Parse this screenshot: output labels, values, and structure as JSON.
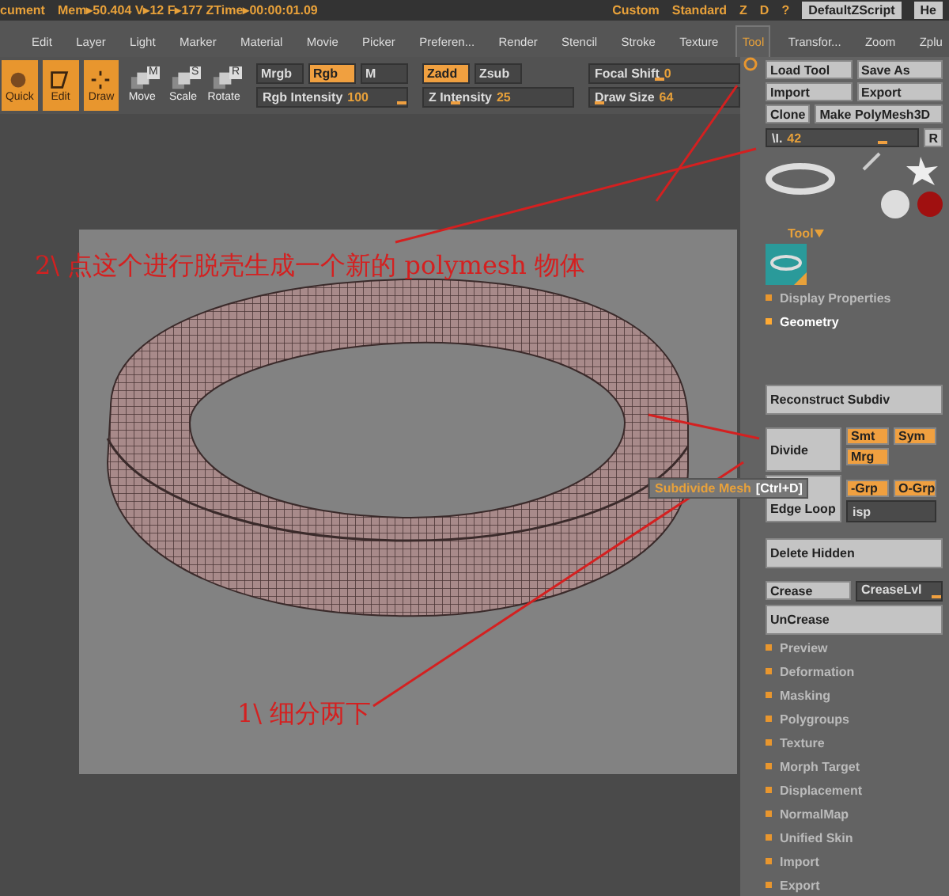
{
  "title_bar": {
    "document": "cument",
    "stats": "Mem▸50.404 V▸12 F▸177 ZTime▸00:00:01.09",
    "layout_items": [
      "Custom",
      "Standard",
      "Z",
      "D",
      "?"
    ],
    "buttons": [
      "DefaultZScript",
      "He"
    ]
  },
  "menu": [
    {
      "label": "Edit",
      "selected": false
    },
    {
      "label": "Layer",
      "selected": false
    },
    {
      "label": "Light",
      "selected": false
    },
    {
      "label": "Marker",
      "selected": false
    },
    {
      "label": "Material",
      "selected": false
    },
    {
      "label": "Movie",
      "selected": false
    },
    {
      "label": "Picker",
      "selected": false
    },
    {
      "label": "Preferen...",
      "selected": false
    },
    {
      "label": "Render",
      "selected": false
    },
    {
      "label": "Stencil",
      "selected": false
    },
    {
      "label": "Stroke",
      "selected": false
    },
    {
      "label": "Texture",
      "selected": false
    },
    {
      "label": "Tool",
      "selected": true
    },
    {
      "label": "Transfor...",
      "selected": false
    },
    {
      "label": "Zoom",
      "selected": false
    },
    {
      "label": "Zplu",
      "selected": false
    }
  ],
  "toolbar": {
    "modes": [
      {
        "label": "Quick",
        "kind": "quick",
        "on": true
      },
      {
        "label": "Edit",
        "kind": "edit",
        "on": true
      },
      {
        "label": "Draw",
        "kind": "draw",
        "on": true
      },
      {
        "label": "Move",
        "kind": "move",
        "letter": "M",
        "on": false
      },
      {
        "label": "Scale",
        "kind": "scale",
        "letter": "S",
        "on": false
      },
      {
        "label": "Rotate",
        "kind": "rotate",
        "letter": "R",
        "on": false
      }
    ],
    "groups": [
      {
        "toggles": [
          {
            "label": "Mrgb",
            "on": false
          },
          {
            "label": "Rgb",
            "on": true
          },
          {
            "label": "M",
            "on": false
          }
        ],
        "sliders": [
          {
            "label": "Rgb Intensity",
            "value": "100",
            "level": 1.0
          }
        ]
      },
      {
        "toggles": [
          {
            "label": "Zadd",
            "on": true
          },
          {
            "label": "Zsub",
            "on": false
          }
        ],
        "sliders": [
          {
            "label": "Z Intensity",
            "value": "25",
            "level": 0.25
          }
        ]
      },
      {
        "sliders": [
          {
            "label": "Focal Shift",
            "value": "0",
            "level": 0.5
          },
          {
            "label": "Draw Size",
            "value": "64",
            "level": 0.1
          }
        ]
      }
    ]
  },
  "annotations": [
    {
      "text": "2\\ 点这个进行脱壳生成一个新的 polymesh 物体",
      "kind": "top"
    },
    {
      "text": "1\\ 细分两下",
      "kind": "bottom"
    }
  ],
  "tooltip": {
    "text": "Subdivide Mesh",
    "shortcut": "[Ctrl+D]"
  },
  "tool_panel": {
    "button_rows": [
      [
        "Load Tool",
        "Save As"
      ],
      [
        "Import",
        "Export"
      ],
      [
        "Clone",
        "Make PolyMesh3D"
      ]
    ],
    "slider": {
      "label": "\\I.",
      "value": "42",
      "level": 0.8,
      "button": "R"
    },
    "tool_menu": "Tool",
    "sections_top": [
      {
        "label": "Display Properties",
        "expanded": false
      },
      {
        "label": "Geometry",
        "expanded": true
      }
    ],
    "geometry": {
      "reconstruct": "Reconstruct Subdiv",
      "divide": "Divide",
      "toggles": [
        {
          "label": "Smt",
          "on": true
        },
        {
          "label": "Sym",
          "on": true
        },
        {
          "label": "Mrg",
          "on": true
        }
      ],
      "group_toggles": [
        {
          "label": "-Grp",
          "on": true
        },
        {
          "label": "O-Grp",
          "on": true
        }
      ],
      "edge_loop": "Edge Loop",
      "disp": "isp",
      "delete_hidden": "Delete Hidden",
      "crease": "Crease",
      "crease_level": {
        "label": "CreaseLvl",
        "level": 1.0
      },
      "uncrease": "UnCrease"
    },
    "sections": [
      {
        "label": "Preview",
        "expanded": false
      },
      {
        "label": "Deformation",
        "expanded": false
      },
      {
        "label": "Masking",
        "expanded": false
      },
      {
        "label": "Polygroups",
        "expanded": false
      },
      {
        "label": "Texture",
        "expanded": false
      },
      {
        "label": "Morph Target",
        "expanded": false
      },
      {
        "label": "Displacement",
        "expanded": false
      },
      {
        "label": "NormalMap",
        "expanded": false
      },
      {
        "label": "Unified Skin",
        "expanded": false
      },
      {
        "label": "Import",
        "expanded": false
      },
      {
        "label": "Export",
        "expanded": false
      }
    ]
  }
}
